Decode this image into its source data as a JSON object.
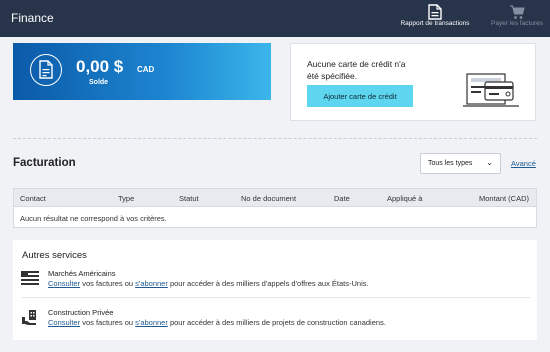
{
  "header": {
    "title": "Finance",
    "actions": [
      {
        "label": "Rapport de transactions",
        "icon": "document-icon"
      },
      {
        "label": "Payer les factures",
        "icon": "cart-icon"
      }
    ]
  },
  "balance": {
    "amount": "0,00 $",
    "currency": "CAD",
    "label": "Solde",
    "icon": "invoice-icon"
  },
  "credit_card": {
    "message": "Aucune carte de crédit n'a été spécifiée.",
    "button_label": "Ajouter carte de crédit",
    "illustration": "credit-card-reader-icon"
  },
  "billing": {
    "title": "Facturation",
    "filter": {
      "selected": "Tous les types"
    },
    "advanced_link": "Avancé",
    "columns": [
      "Contact",
      "Type",
      "Statut",
      "No de document",
      "Date",
      "Appliqué à",
      "Montant (CAD)"
    ],
    "empty_message": "Aucun résultat ne correspond à vos critères."
  },
  "services": {
    "title": "Autres services",
    "items": [
      {
        "name": "Marchés Américains",
        "icon": "us-flag-icon",
        "link1": "Consulter",
        "text1": " vos factures ou ",
        "link2": "s'abonner",
        "text2": " pour accéder à des milliers d'appels d'offres aux États-Unis."
      },
      {
        "name": "Construction Privée",
        "icon": "building-hand-icon",
        "link1": "Consulter",
        "text1": " vos factures ou ",
        "link2": "s'abonner",
        "text2": " pour accéder à des milliers de projets de construction canadiens."
      }
    ]
  },
  "colors": {
    "topbar": "#273449",
    "accent_button": "#5ed6ef",
    "link": "#1f5a91",
    "balance_gradient_start": "#0b5aa8",
    "balance_gradient_end": "#3bb6ea"
  }
}
